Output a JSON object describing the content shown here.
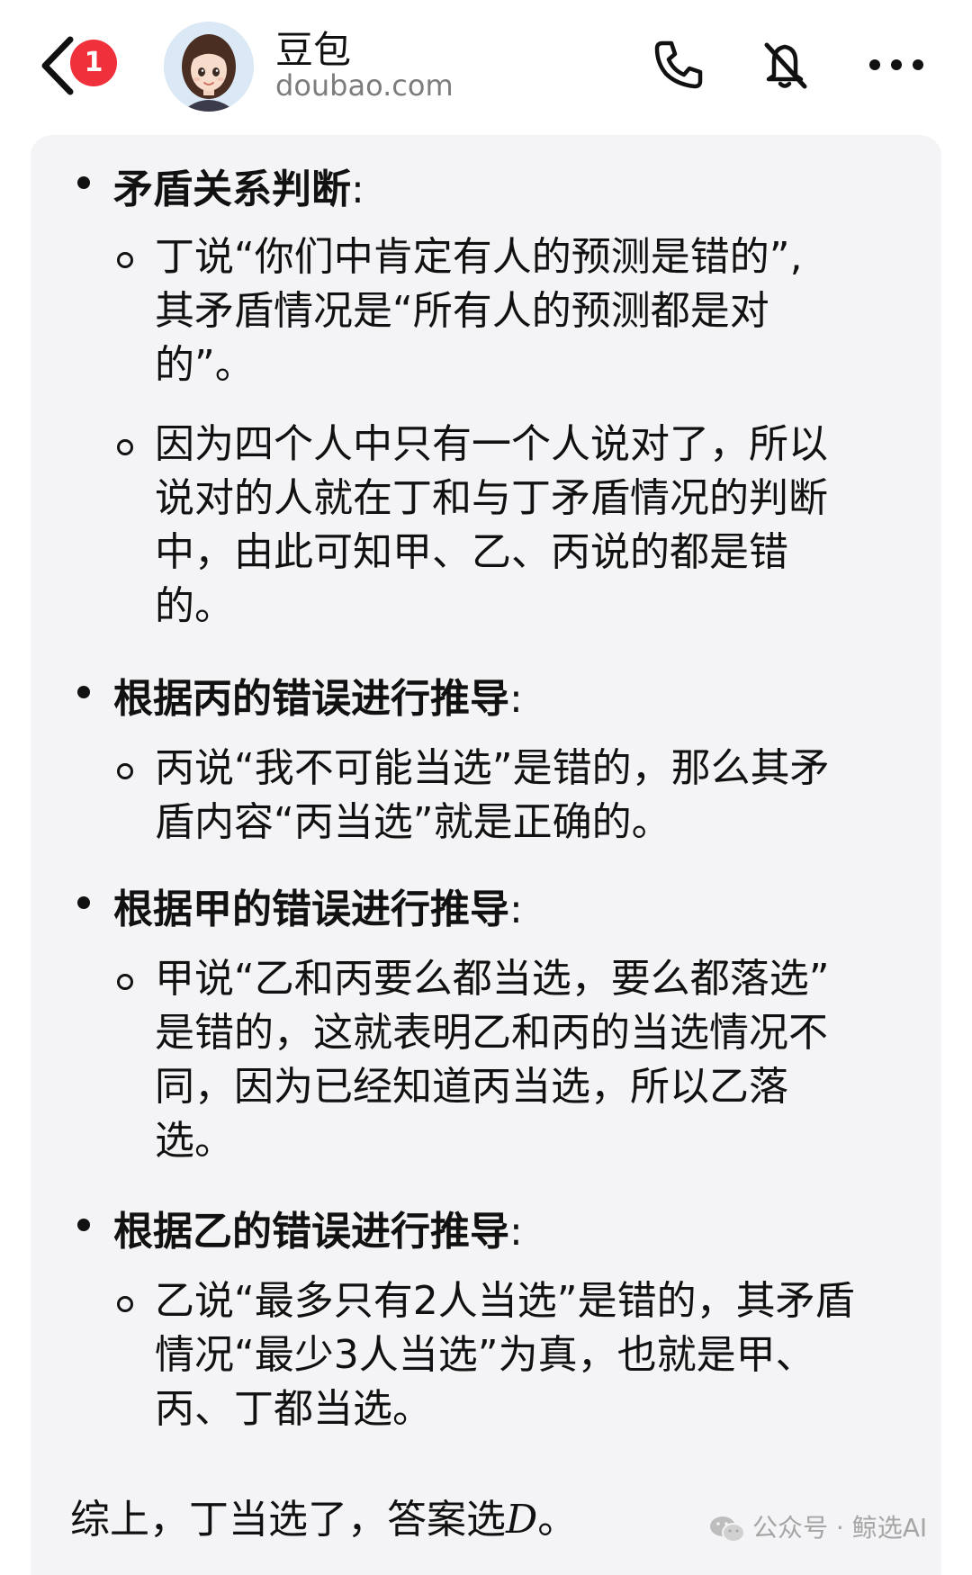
{
  "header": {
    "unread_count": "1",
    "bot_name": "豆包",
    "bot_domain": "doubao.com"
  },
  "message": {
    "sections": [
      {
        "title": "矛盾关系判断",
        "colon": ":",
        "items": [
          {
            "lines": [
              "丁说“你们中肯定有人的预测是错的”,",
              "其矛盾情况是“所有人的预测都是对",
              "的”。"
            ]
          },
          {
            "lines": [
              "因为四个人中只有一个人说对了，所以",
              "说对的人就在丁和与丁矛盾情况的判断",
              "中，由此可知甲、乙、丙说的都是错",
              "的。"
            ]
          }
        ]
      },
      {
        "title": "根据丙的错误进行推导",
        "colon": ":",
        "items": [
          {
            "lines": [
              "丙说“我不可能当选”是错的，那么其矛",
              "盾内容“丙当选”就是正确的。"
            ]
          }
        ]
      },
      {
        "title": "根据甲的错误进行推导",
        "colon": ":",
        "items": [
          {
            "lines": [
              "甲说“乙和丙要么都当选，要么都落选”",
              "是错的，这就表明乙和丙的当选情况不",
              "同，因为已经知道丙当选，所以乙落",
              "选。"
            ]
          }
        ]
      },
      {
        "title": "根据乙的错误进行推导",
        "colon": ":",
        "items": [
          {
            "lines": [
              "乙说“最多只有2人当选”是错的，其矛盾",
              "情况“最少3人当选”为真，也就是甲、",
              "丙、丁都当选。"
            ]
          }
        ]
      }
    ],
    "summary_prefix": "综上，丁当选了，答案选",
    "summary_answer": "D",
    "summary_suffix": "。"
  },
  "watermark": {
    "text": "公众号 · 鲸选AI"
  }
}
